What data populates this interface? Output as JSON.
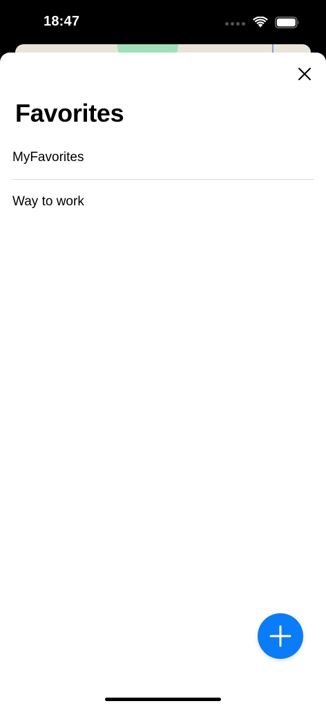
{
  "status_bar": {
    "time": "18:47"
  },
  "sheet": {
    "title": "Favorites",
    "favorites": [
      {
        "label": "MyFavorites"
      },
      {
        "label": "Way to work"
      }
    ]
  },
  "icons": {
    "close": "close-icon",
    "add": "plus-icon",
    "wifi": "wifi-icon",
    "battery": "battery-icon",
    "signal": "cellular-signal-icon"
  },
  "colors": {
    "accent": "#0a7cf7",
    "sheet_background": "#ffffff",
    "status_bar_background": "#000000",
    "divider": "#d9d9dc"
  }
}
